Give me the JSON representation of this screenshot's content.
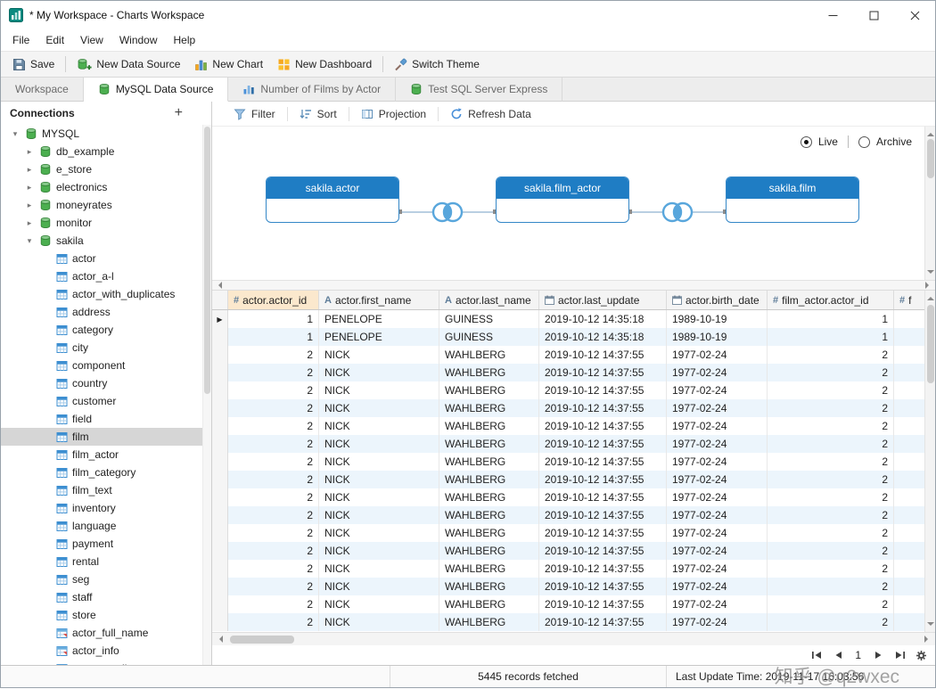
{
  "window": {
    "title": "* My Workspace - Charts Workspace"
  },
  "menu": {
    "items": [
      "File",
      "Edit",
      "View",
      "Window",
      "Help"
    ]
  },
  "toolbar": {
    "items": [
      {
        "label": "Save",
        "icon": "save-icon"
      },
      {
        "label": "New Data Source",
        "icon": "new-data-source-icon"
      },
      {
        "label": "New Chart",
        "icon": "new-chart-icon"
      },
      {
        "label": "New Dashboard",
        "icon": "new-dashboard-icon"
      },
      {
        "label": "Switch Theme",
        "icon": "switch-theme-icon"
      }
    ]
  },
  "tabs": [
    {
      "label": "Workspace",
      "icon": "",
      "active": false
    },
    {
      "label": "MySQL Data Source",
      "icon": "database-icon",
      "active": true
    },
    {
      "label": "Number of Films by Actor",
      "icon": "chart-tab-icon",
      "active": false
    },
    {
      "label": "Test SQL Server Express",
      "icon": "database-icon",
      "active": false
    }
  ],
  "sidebar": {
    "title": "Connections",
    "tree": [
      {
        "label": "MYSQL",
        "level": 0,
        "type": "connection",
        "expanded": true
      },
      {
        "label": "db_example",
        "level": 1,
        "type": "database",
        "expanded": false
      },
      {
        "label": "e_store",
        "level": 1,
        "type": "database",
        "expanded": false
      },
      {
        "label": "electronics",
        "level": 1,
        "type": "database",
        "expanded": false
      },
      {
        "label": "moneyrates",
        "level": 1,
        "type": "database",
        "expanded": false
      },
      {
        "label": "monitor",
        "level": 1,
        "type": "database",
        "expanded": false
      },
      {
        "label": "sakila",
        "level": 1,
        "type": "database",
        "expanded": true
      },
      {
        "label": "actor",
        "level": 2,
        "type": "table"
      },
      {
        "label": "actor_a-l",
        "level": 2,
        "type": "table"
      },
      {
        "label": "actor_with_duplicates",
        "level": 2,
        "type": "table"
      },
      {
        "label": "address",
        "level": 2,
        "type": "table"
      },
      {
        "label": "category",
        "level": 2,
        "type": "table"
      },
      {
        "label": "city",
        "level": 2,
        "type": "table"
      },
      {
        "label": "component",
        "level": 2,
        "type": "table"
      },
      {
        "label": "country",
        "level": 2,
        "type": "table"
      },
      {
        "label": "customer",
        "level": 2,
        "type": "table"
      },
      {
        "label": "field",
        "level": 2,
        "type": "table"
      },
      {
        "label": "film",
        "level": 2,
        "type": "table",
        "selected": true
      },
      {
        "label": "film_actor",
        "level": 2,
        "type": "table"
      },
      {
        "label": "film_category",
        "level": 2,
        "type": "table"
      },
      {
        "label": "film_text",
        "level": 2,
        "type": "table"
      },
      {
        "label": "inventory",
        "level": 2,
        "type": "table"
      },
      {
        "label": "language",
        "level": 2,
        "type": "table"
      },
      {
        "label": "payment",
        "level": 2,
        "type": "table"
      },
      {
        "label": "rental",
        "level": 2,
        "type": "table"
      },
      {
        "label": "seg",
        "level": 2,
        "type": "table"
      },
      {
        "label": "staff",
        "level": 2,
        "type": "table"
      },
      {
        "label": "store",
        "level": 2,
        "type": "table"
      },
      {
        "label": "actor_full_name",
        "level": 2,
        "type": "view"
      },
      {
        "label": "actor_info",
        "level": 2,
        "type": "view"
      },
      {
        "label": "customer_list",
        "level": 2,
        "type": "view"
      }
    ]
  },
  "query_toolbar": {
    "items": [
      {
        "label": "Filter",
        "icon": "filter-icon"
      },
      {
        "label": "Sort",
        "icon": "sort-icon"
      },
      {
        "label": "Projection",
        "icon": "projection-icon"
      },
      {
        "label": "Refresh Data",
        "icon": "refresh-icon"
      }
    ]
  },
  "mode": {
    "options": [
      "Live",
      "Archive"
    ],
    "selected": "Live"
  },
  "diagram": {
    "nodes": [
      "sakila.actor",
      "sakila.film_actor",
      "sakila.film"
    ]
  },
  "grid": {
    "columns": [
      {
        "label": "actor.actor_id",
        "type": "number",
        "selected": true
      },
      {
        "label": "actor.first_name",
        "type": "text",
        "selected": false
      },
      {
        "label": "actor.last_name",
        "type": "text",
        "selected": false
      },
      {
        "label": "actor.last_update",
        "type": "date",
        "selected": false
      },
      {
        "label": "actor.birth_date",
        "type": "date",
        "selected": false
      },
      {
        "label": "film_actor.actor_id",
        "type": "number",
        "selected": false
      },
      {
        "label": "f",
        "type": "number",
        "selected": false
      }
    ],
    "rows": [
      [
        "1",
        "PENELOPE",
        "GUINESS",
        "2019-10-12 14:35:18",
        "1989-10-19",
        "1",
        ""
      ],
      [
        "1",
        "PENELOPE",
        "GUINESS",
        "2019-10-12 14:35:18",
        "1989-10-19",
        "1",
        ""
      ],
      [
        "2",
        "NICK",
        "WAHLBERG",
        "2019-10-12 14:37:55",
        "1977-02-24",
        "2",
        ""
      ],
      [
        "2",
        "NICK",
        "WAHLBERG",
        "2019-10-12 14:37:55",
        "1977-02-24",
        "2",
        ""
      ],
      [
        "2",
        "NICK",
        "WAHLBERG",
        "2019-10-12 14:37:55",
        "1977-02-24",
        "2",
        ""
      ],
      [
        "2",
        "NICK",
        "WAHLBERG",
        "2019-10-12 14:37:55",
        "1977-02-24",
        "2",
        ""
      ],
      [
        "2",
        "NICK",
        "WAHLBERG",
        "2019-10-12 14:37:55",
        "1977-02-24",
        "2",
        ""
      ],
      [
        "2",
        "NICK",
        "WAHLBERG",
        "2019-10-12 14:37:55",
        "1977-02-24",
        "2",
        ""
      ],
      [
        "2",
        "NICK",
        "WAHLBERG",
        "2019-10-12 14:37:55",
        "1977-02-24",
        "2",
        ""
      ],
      [
        "2",
        "NICK",
        "WAHLBERG",
        "2019-10-12 14:37:55",
        "1977-02-24",
        "2",
        ""
      ],
      [
        "2",
        "NICK",
        "WAHLBERG",
        "2019-10-12 14:37:55",
        "1977-02-24",
        "2",
        ""
      ],
      [
        "2",
        "NICK",
        "WAHLBERG",
        "2019-10-12 14:37:55",
        "1977-02-24",
        "2",
        ""
      ],
      [
        "2",
        "NICK",
        "WAHLBERG",
        "2019-10-12 14:37:55",
        "1977-02-24",
        "2",
        ""
      ],
      [
        "2",
        "NICK",
        "WAHLBERG",
        "2019-10-12 14:37:55",
        "1977-02-24",
        "2",
        ""
      ],
      [
        "2",
        "NICK",
        "WAHLBERG",
        "2019-10-12 14:37:55",
        "1977-02-24",
        "2",
        ""
      ],
      [
        "2",
        "NICK",
        "WAHLBERG",
        "2019-10-12 14:37:55",
        "1977-02-24",
        "2",
        ""
      ],
      [
        "2",
        "NICK",
        "WAHLBERG",
        "2019-10-12 14:37:55",
        "1977-02-24",
        "2",
        ""
      ],
      [
        "2",
        "NICK",
        "WAHLBERG",
        "2019-10-12 14:37:55",
        "1977-02-24",
        "2",
        ""
      ]
    ]
  },
  "pagination": {
    "page": "1"
  },
  "status": {
    "records": "5445 records fetched",
    "last_update": "Last Update Time: 2019-11-17 16:03:56"
  },
  "watermark": "知乎 @q2wxec",
  "colors": {
    "accent_blue": "#1f7dc4",
    "node_border": "#3487c7",
    "row_alt": "#ecf5fc",
    "header_selected": "#fbe8cd",
    "icon_green": "#43a047",
    "icon_blue": "#3d8fd1"
  }
}
